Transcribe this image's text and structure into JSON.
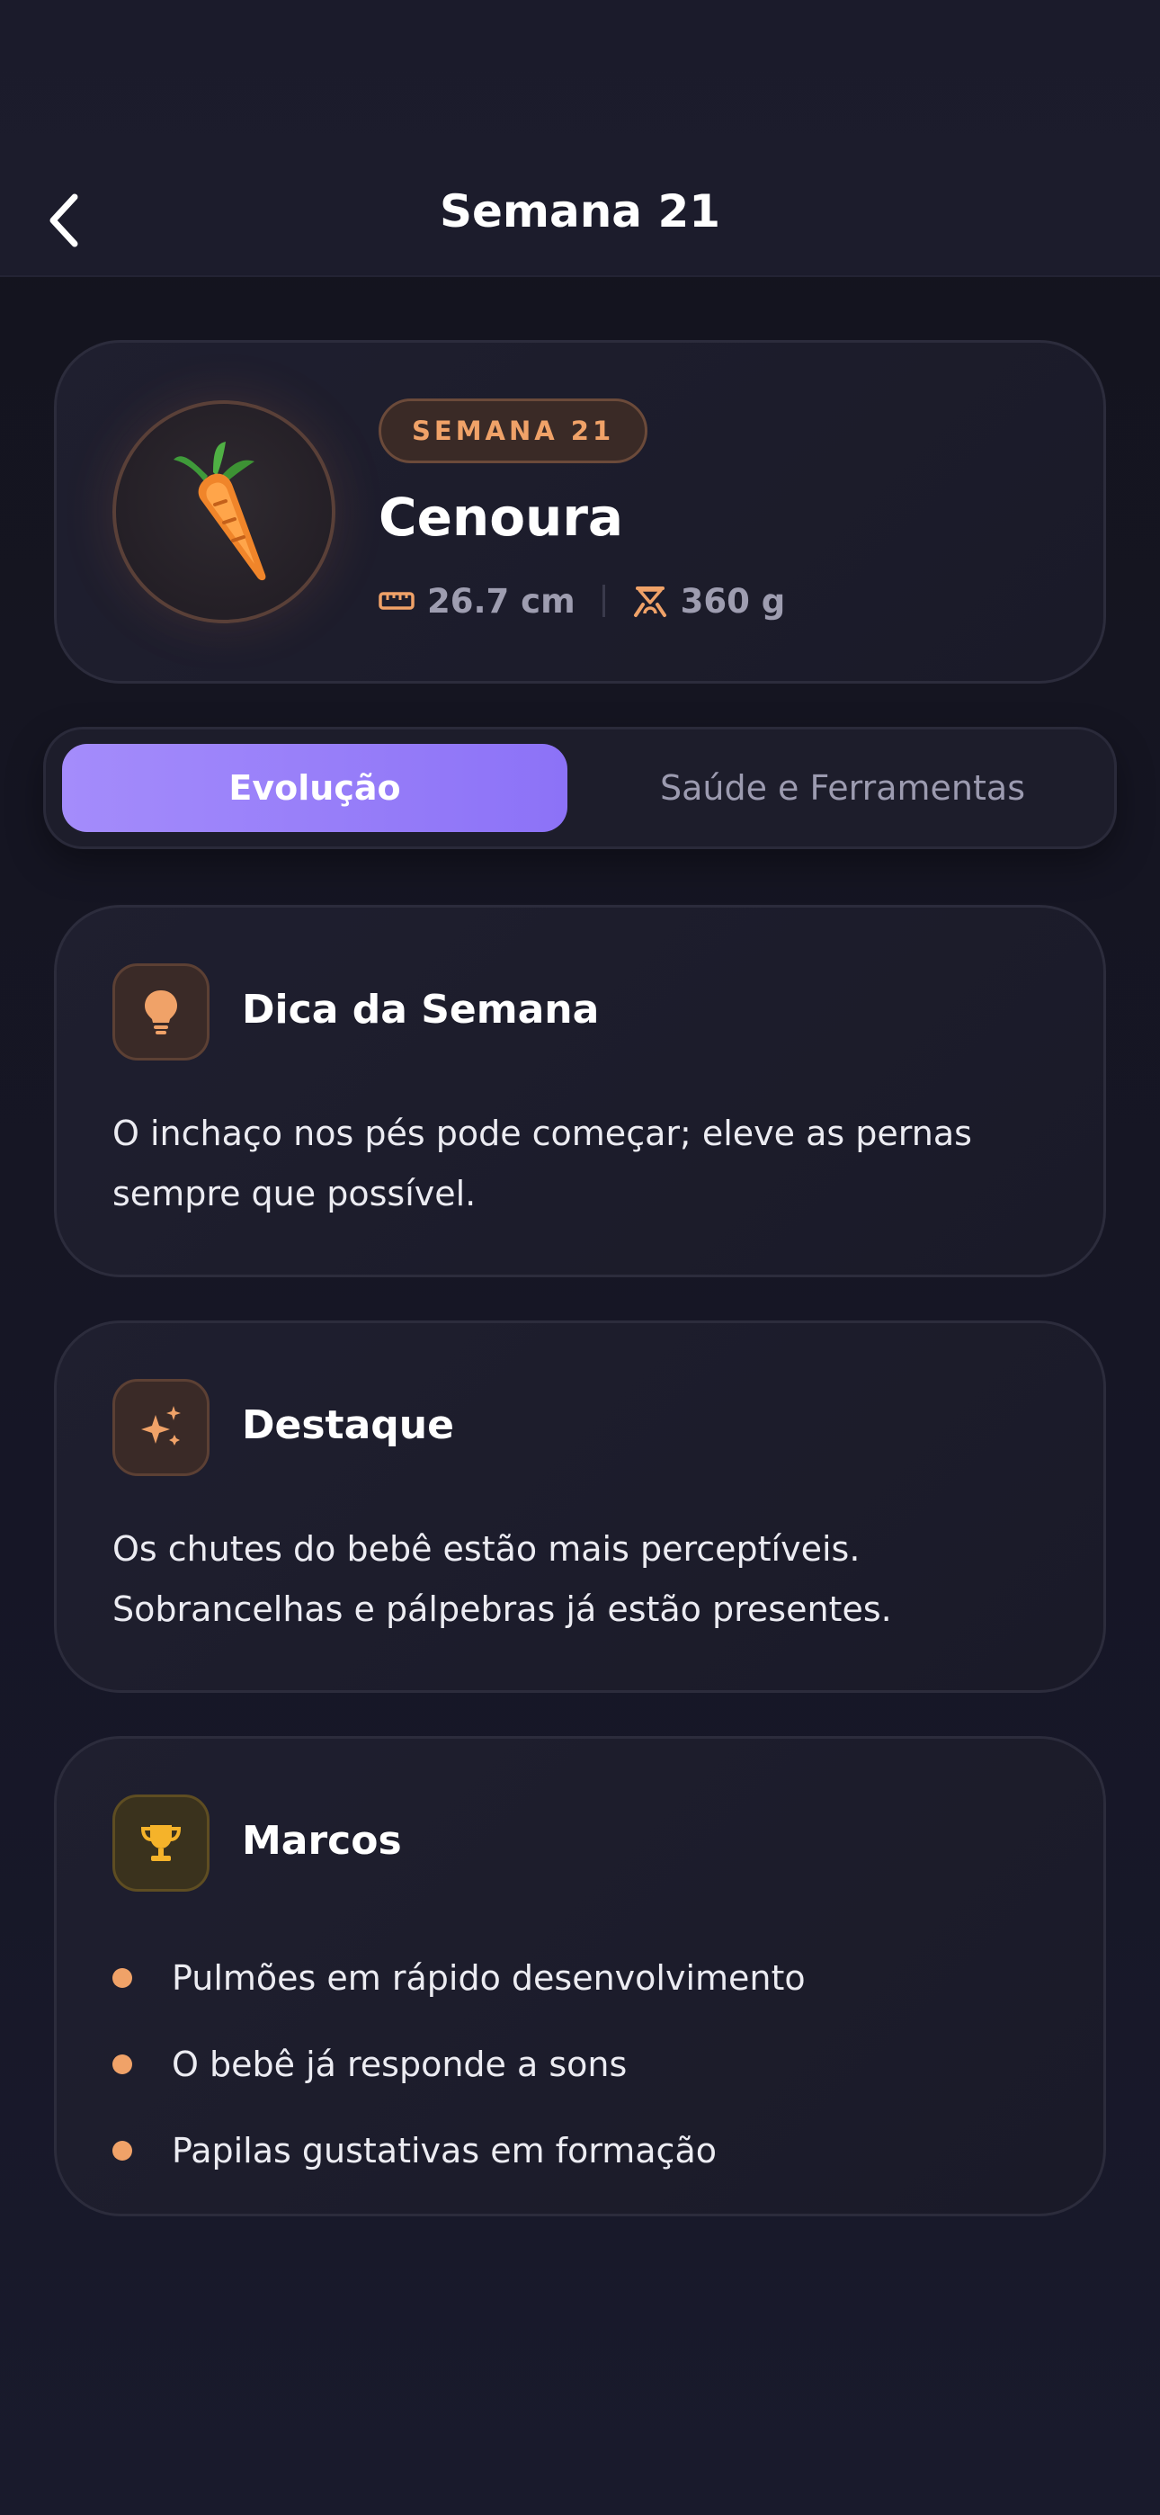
{
  "header": {
    "title": "Semana 21",
    "back_icon": "chevron-left-icon"
  },
  "hero": {
    "badge": "SEMANA 21",
    "fruit_name": "Cenoura",
    "fruit_icon": "carrot-icon",
    "length": "26.7 cm",
    "length_icon": "ruler-icon",
    "weight": "360 g",
    "weight_icon": "scale-icon"
  },
  "tabs": [
    {
      "label": "Evolução",
      "active": true
    },
    {
      "label": "Saúde e Ferramentas",
      "active": false
    }
  ],
  "cards": {
    "tip": {
      "title": "Dica da Semana",
      "icon": "lightbulb-icon",
      "text": "O inchaço nos pés pode começar; eleve as pernas sempre que possível."
    },
    "highlight": {
      "title": "Destaque",
      "icon": "sparkles-icon",
      "text": "Os chutes do bebê estão mais perceptíveis. Sobrancelhas e pálpebras já estão presentes."
    },
    "milestones": {
      "title": "Marcos",
      "icon": "trophy-icon",
      "items": [
        "Pulmões em rápido desenvolvimento",
        "O bebê já responde a sons",
        "Papilas gustativas em formação"
      ]
    }
  },
  "colors": {
    "accent": "#f0a268",
    "tab_active_start": "#a48cfb",
    "tab_active_end": "#8c72f7",
    "gold": "#f5b32a"
  }
}
